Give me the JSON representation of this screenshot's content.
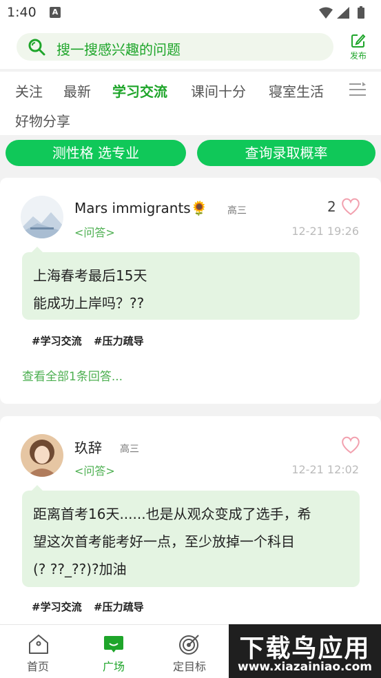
{
  "status_bar": {
    "time": "1:40",
    "notification_icon": "A"
  },
  "search": {
    "placeholder": "搜一搜感兴趣的问题"
  },
  "publish": {
    "label": "发布"
  },
  "tabs": [
    {
      "label": "关注",
      "active": false
    },
    {
      "label": "最新",
      "active": false
    },
    {
      "label": "学习交流",
      "active": true
    },
    {
      "label": "课间十分",
      "active": false
    },
    {
      "label": "寝室生活",
      "active": false
    },
    {
      "label": "好物分享",
      "active": false
    }
  ],
  "actions": [
    {
      "label": "测性格 选专业"
    },
    {
      "label": "查询录取概率"
    }
  ],
  "posts": [
    {
      "author": "Mars immigrants🌻",
      "grade": "高三",
      "qa_tag": "<问答>",
      "time": "12-21 19:26",
      "likes": "2",
      "content_lines": [
        "上海春考最后15天",
        "能成功上岸吗？??"
      ],
      "tags": [
        "#学习交流",
        "#压力疏导"
      ],
      "view_all": "查看全部1条回答..."
    },
    {
      "author": "玖辞",
      "grade": "高三",
      "qa_tag": "<问答>",
      "time": "12-21 12:02",
      "likes": "",
      "content_lines": [
        "距离首考16天......也是从观众变成了选手，希",
        "望这次首考能考好一点，至少放掉一个科目",
        "(? ??_??)?加油"
      ],
      "tags": [
        "#学习交流",
        "#压力疏导"
      ]
    }
  ],
  "bottom_nav": [
    {
      "label": "首页",
      "icon": "home-icon",
      "active": false
    },
    {
      "label": "广场",
      "icon": "chat-icon",
      "active": true
    },
    {
      "label": "定目标",
      "icon": "target-icon",
      "active": false
    }
  ],
  "watermark": {
    "title": "下载鸟应用",
    "url": "www.xiazainiao.com"
  },
  "colors": {
    "accent": "#1ea52a",
    "button": "#10c859",
    "bubble": "#e4f4e2"
  }
}
